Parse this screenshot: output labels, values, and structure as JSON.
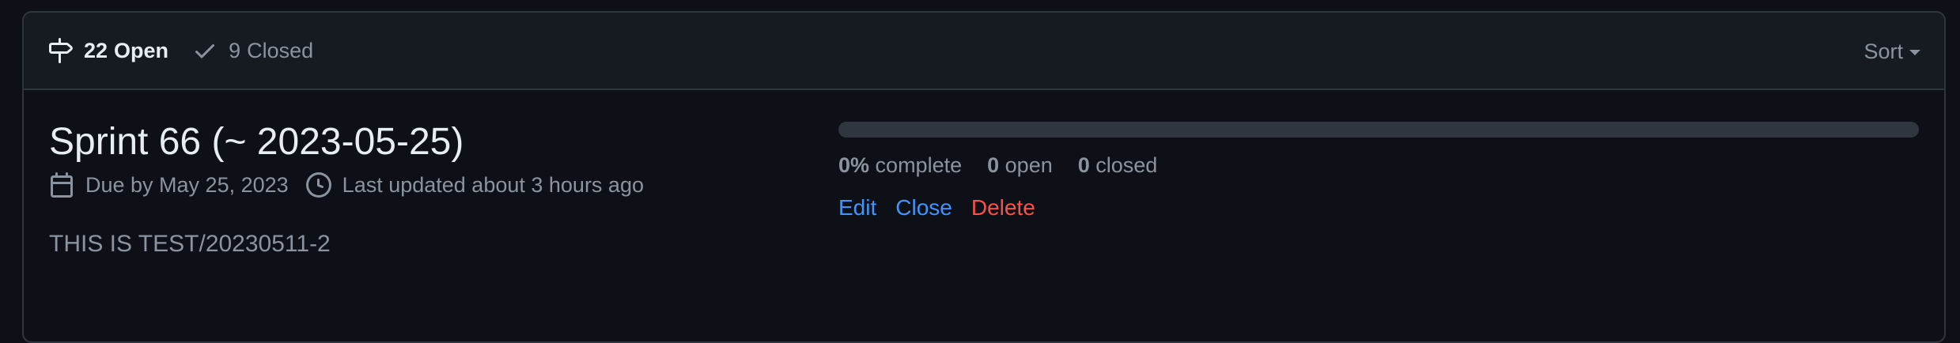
{
  "header": {
    "open_count": "22",
    "open_label": "Open",
    "closed_count": "9",
    "closed_label": "Closed",
    "sort_label": "Sort"
  },
  "milestone": {
    "title": "Sprint 66 (~ 2023-05-25)",
    "due_text": "Due by May 25, 2023",
    "updated_text": "Last updated about 3 hours ago",
    "description": "THIS IS TEST/20230511-2",
    "progress_fraction": 0,
    "percent_value": "0%",
    "percent_label": "complete",
    "open_value": "0",
    "open_label": "open",
    "closed_value": "0",
    "closed_label": "closed",
    "actions": {
      "edit": "Edit",
      "close": "Close",
      "delete": "Delete"
    }
  },
  "colors": {
    "background": "#0d1117",
    "header_background": "#161b22",
    "border": "#30363d",
    "link": "#4493f8",
    "danger": "#f85149",
    "muted_text": "#8b949e"
  },
  "icons": {
    "open": "milestone-icon",
    "closed": "check-icon",
    "due": "calendar-icon",
    "updated": "clock-icon"
  }
}
